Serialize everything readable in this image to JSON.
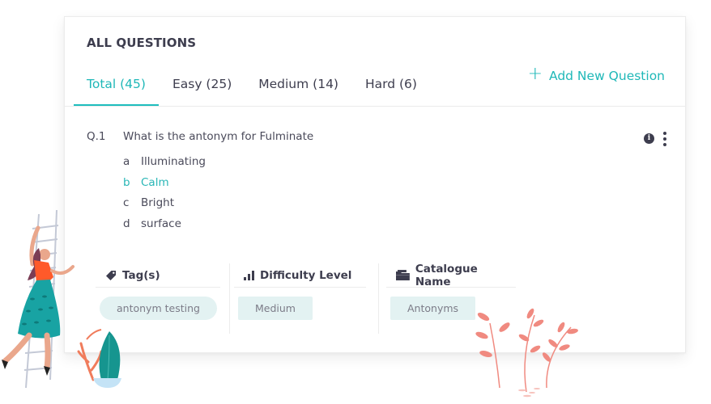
{
  "page": {
    "title": "ALL QUESTIONS",
    "tabs": [
      {
        "label": "Total (45)",
        "active": true
      },
      {
        "label": "Easy (25)",
        "active": false
      },
      {
        "label": "Medium (14)",
        "active": false
      },
      {
        "label": "Hard (6)",
        "active": false
      }
    ],
    "add_button": {
      "icon": "plus-icon",
      "label": "Add New Question"
    },
    "accent_color": "#1fb8b8"
  },
  "question": {
    "number": "Q.1",
    "text": "What is the antonym for Fulminate",
    "options": [
      {
        "letter": "a",
        "text": "Illuminating",
        "correct": false
      },
      {
        "letter": "b",
        "text": "Calm",
        "correct": true
      },
      {
        "letter": "c",
        "text": "Bright",
        "correct": false
      },
      {
        "letter": "d",
        "text": "surface",
        "correct": false
      }
    ],
    "actions": {
      "info_icon": "info-icon",
      "more_icon": "more-vertical-icon"
    }
  },
  "meta": {
    "tags": {
      "icon": "tag-icon",
      "label": "Tag(s)",
      "value": "antonym testing"
    },
    "difficulty": {
      "icon": "bar-chart-icon",
      "label": "Difficulty Level",
      "value": "Medium"
    },
    "catalogue": {
      "icon": "folder-icon",
      "label": "Catalogue Name",
      "value": "Antonyms"
    }
  }
}
